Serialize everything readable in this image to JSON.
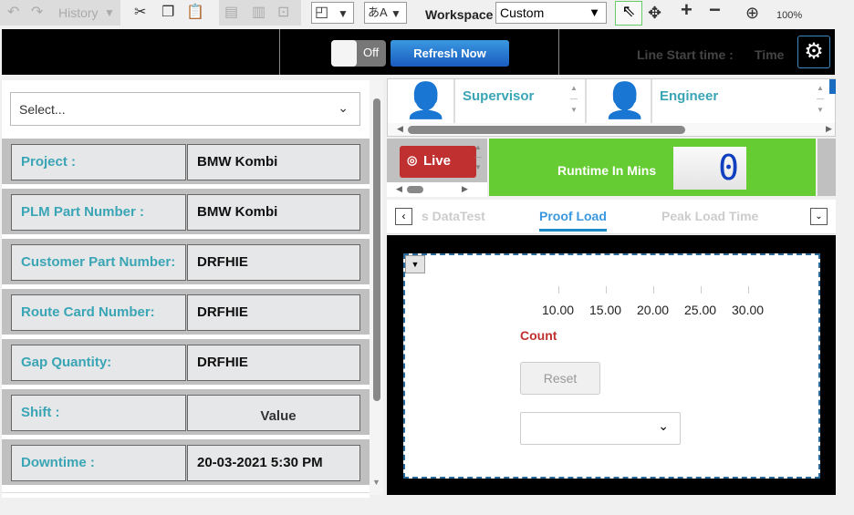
{
  "toolbar": {
    "history": "History",
    "workspace_label": "Workspace",
    "workspace_value": "Custom",
    "zoom": "100%"
  },
  "header": {
    "toggle": "Off",
    "refresh": "Refresh Now",
    "line_start_label": "Line Start time :",
    "line_start_value": "Time"
  },
  "left": {
    "select_placeholder": "Select...",
    "fields": [
      {
        "label": "Project :",
        "value": "BMW Kombi"
      },
      {
        "label": "PLM Part Number :",
        "value": "BMW Kombi"
      },
      {
        "label": "Customer Part Number:",
        "value": "DRFHIE"
      },
      {
        "label": "Route Card Number:",
        "value": "DRFHIE"
      },
      {
        "label": "Gap Quantity:",
        "value": "DRFHIE"
      },
      {
        "label": "Shift :",
        "value": "Value"
      },
      {
        "label": "Downtime :",
        "value": "20-03-2021 5:30 PM"
      }
    ]
  },
  "people": [
    {
      "role": "Supervisor"
    },
    {
      "role": "Engineer"
    }
  ],
  "status": {
    "live": "Live",
    "runtime_label": "Runtime In Mins",
    "runtime_value": "0",
    "runtime_bg": "#66cc33",
    "live_bg": "#c03030"
  },
  "tabs": [
    {
      "label": "s DataTest",
      "active": false
    },
    {
      "label": "Proof Load",
      "active": true
    },
    {
      "label": "Peak Load Time",
      "active": false
    }
  ],
  "chart_panel": {
    "ticks": [
      "10.00",
      "15.00",
      "20.00",
      "25.00",
      "30.00"
    ],
    "count_label": "Count",
    "reset": "Reset"
  }
}
